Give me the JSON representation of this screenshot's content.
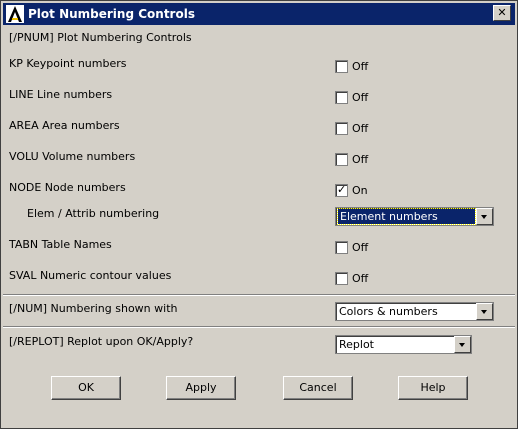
{
  "window": {
    "title": "Plot Numbering Controls",
    "close_glyph": "✕",
    "app_icon": "ansys-logo-icon"
  },
  "header": {
    "label": "[/PNUM]  Plot Numbering Controls"
  },
  "options": [
    {
      "label": "KP    Keypoint numbers",
      "state": "Off",
      "checked": false
    },
    {
      "label": "LINE  Line numbers",
      "state": "Off",
      "checked": false
    },
    {
      "label": "AREA  Area numbers",
      "state": "Off",
      "checked": false
    },
    {
      "label": "VOLU  Volume numbers",
      "state": "Off",
      "checked": false
    },
    {
      "label": "NODE  Node numbers",
      "state": "On",
      "checked": true
    }
  ],
  "elem_attrib": {
    "label": "Elem / Attrib numbering",
    "value": "Element numbers"
  },
  "options2": [
    {
      "label": "TABN  Table Names",
      "state": "Off",
      "checked": false
    },
    {
      "label": "SVAL  Numeric contour values",
      "state": "Off",
      "checked": false
    }
  ],
  "num": {
    "label": "[/NUM]  Numbering shown with",
    "value": "Colors & numbers"
  },
  "replot": {
    "label": "[/REPLOT]  Replot upon OK/Apply?",
    "value": "Replot"
  },
  "buttons": {
    "ok": "OK",
    "apply": "Apply",
    "cancel": "Cancel",
    "help": "Help"
  }
}
